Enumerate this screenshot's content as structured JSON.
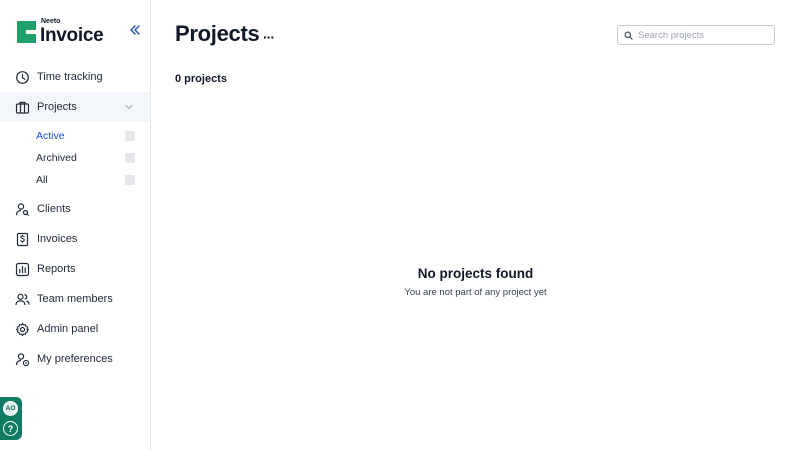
{
  "brand": {
    "small": "Neeto",
    "big": "Invoice",
    "color": "#22a06b"
  },
  "sidebar": {
    "items": [
      {
        "label": "Time tracking",
        "icon": "clock-icon"
      },
      {
        "label": "Projects",
        "icon": "briefcase-icon"
      },
      {
        "label": "Clients",
        "icon": "user-search-icon"
      },
      {
        "label": "Invoices",
        "icon": "dollar-file-icon"
      },
      {
        "label": "Reports",
        "icon": "report-chart-icon"
      },
      {
        "label": "Team members",
        "icon": "team-icon"
      },
      {
        "label": "Admin panel",
        "icon": "gear-icon"
      },
      {
        "label": "My preferences",
        "icon": "user-settings-icon"
      }
    ],
    "project_filters": [
      {
        "label": "Active",
        "selected": true
      },
      {
        "label": "Archived",
        "selected": false
      },
      {
        "label": "All",
        "selected": false
      }
    ]
  },
  "user": {
    "initials": "AO",
    "help_glyph": "?"
  },
  "main": {
    "title": "Projects",
    "more_glyph": "···",
    "search_placeholder": "Search projects",
    "search_value": "",
    "count_label": "0 projects",
    "empty_title": "No projects found",
    "empty_subtitle": "You are not part of any project yet"
  },
  "colors": {
    "accent": "#1d4ed8",
    "active_group_bg": "#f3f6fb",
    "footer_bg": "#0f7b63"
  }
}
